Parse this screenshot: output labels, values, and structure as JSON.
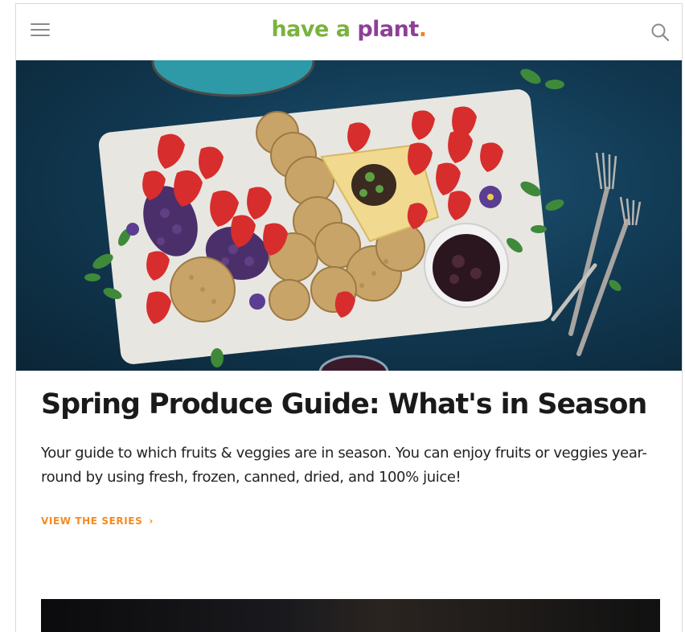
{
  "header": {
    "logo": {
      "part1": "have a",
      "part2": "plant",
      "dot": "."
    },
    "menu_icon": "hamburger-menu-icon",
    "search_icon": "search-icon"
  },
  "hero": {
    "image_description_icon": "charcuterie-board-photo"
  },
  "article": {
    "title": "Spring Produce Guide: What's in Season",
    "description": "Your guide to which fruits & veggies are in season. You can enjoy fruits or veggies year-round by using fresh, frozen, canned, dried, and 100% juice!",
    "cta_label": "VIEW THE SERIES",
    "cta_chevron": "›"
  },
  "colors": {
    "logo_green": "#7ab33d",
    "logo_purple": "#8e3f97",
    "accent_orange": "#f58a1f",
    "hero_bg": "#123b55"
  }
}
